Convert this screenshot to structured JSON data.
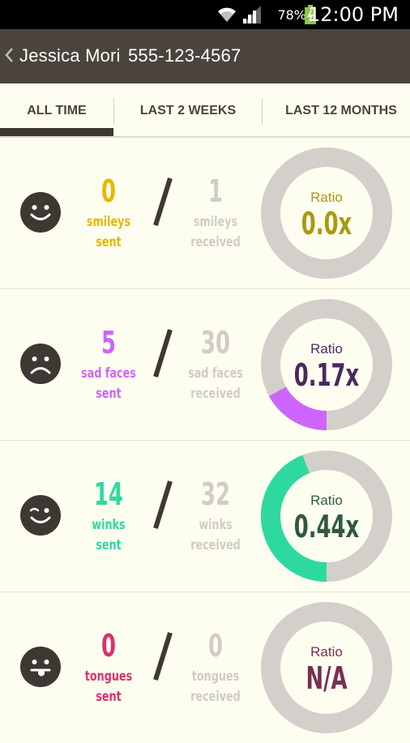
{
  "status_bar": {
    "battery_percent": "78%",
    "time": "12:00 PM"
  },
  "header": {
    "contact_name": "Jessica Mori",
    "phone": "555-123-4567"
  },
  "tabs": [
    {
      "label": "ALL TIME",
      "selected": true
    },
    {
      "label": "LAST 2 WEEKS",
      "selected": false
    },
    {
      "label": "LAST 12 MONTHS",
      "selected": false
    }
  ],
  "rows": [
    {
      "face": "smiley-face-icon",
      "sent_count": "0",
      "sent_label_1": "smileys",
      "sent_label_2": "sent",
      "received_count": "1",
      "received_label_1": "smileys",
      "received_label_2": "received",
      "ratio_label": "Ratio",
      "ratio_value": "0.0x",
      "ratio_fraction": 0.0,
      "accent_color": "#e6b800",
      "value_color": "#a89a12"
    },
    {
      "face": "sad-face-icon",
      "sent_count": "5",
      "sent_label_1": "sad faces",
      "sent_label_2": "sent",
      "received_count": "30",
      "received_label_1": "sad faces",
      "received_label_2": "received",
      "ratio_label": "Ratio",
      "ratio_value": "0.17x",
      "ratio_fraction": 0.17,
      "accent_color": "#cc66ff",
      "value_color": "#4a2a5e"
    },
    {
      "face": "wink-face-icon",
      "sent_count": "14",
      "sent_label_1": "winks",
      "sent_label_2": "sent",
      "received_count": "32",
      "received_label_1": "winks",
      "received_label_2": "received",
      "ratio_label": "Ratio",
      "ratio_value": "0.44x",
      "ratio_fraction": 0.44,
      "accent_color": "#2ed9a0",
      "value_color": "#2f5a40"
    },
    {
      "face": "tongue-face-icon",
      "sent_count": "0",
      "sent_label_1": "tongues",
      "sent_label_2": "sent",
      "received_count": "0",
      "received_label_1": "tongues",
      "received_label_2": "received",
      "ratio_label": "Ratio",
      "ratio_value": "N/A",
      "ratio_fraction": 0.0,
      "accent_color": "#d6336c",
      "value_color": "#7a2e52"
    }
  ],
  "colors": {
    "header_bg": "#4a443d",
    "page_bg": "#fdfdf0",
    "ring_track": "#d3cfca",
    "received_text": "#d0ccc6",
    "face_dark": "#3d3832"
  }
}
